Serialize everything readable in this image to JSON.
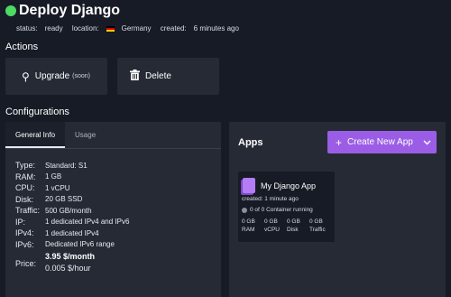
{
  "header": {
    "title": "Deploy Django",
    "status_label": "status:",
    "status_value": "ready",
    "location_label": "location:",
    "location_value": "Germany",
    "created_label": "created:",
    "created_value": "6 minutes ago"
  },
  "actions": {
    "title": "Actions",
    "upgrade_label": "Upgrade",
    "upgrade_note": "(soon)",
    "delete_label": "Delete"
  },
  "configurations": {
    "title": "Configurations",
    "tabs": [
      "General Info",
      "Usage"
    ],
    "specs": [
      {
        "key": "Type:",
        "value": "Standard:  S1"
      },
      {
        "key": "RAM:",
        "value": "1 GB"
      },
      {
        "key": "CPU:",
        "value": "1 vCPU"
      },
      {
        "key": "Disk:",
        "value": "20 GB SSD"
      },
      {
        "key": "Traffic:",
        "value": "500 GB/month"
      },
      {
        "key": "IP:",
        "value": "1 dedicated IPv4 and IPv6"
      },
      {
        "key": "IPv4:",
        "value": "1 dedicated IPv4"
      },
      {
        "key": "IPv6:",
        "value": "Dedicated IPv6 range"
      }
    ],
    "price_label": "Price:",
    "price_month": "3.95 $/month",
    "price_hour": "0.005 $/hour"
  },
  "apps": {
    "title": "Apps",
    "create_label": "Create New App",
    "card": {
      "name": "My Django App",
      "created": "created: 1 minute ago",
      "status": "0 of 0 Container running",
      "stats": [
        {
          "value": "0 GB",
          "label": "RAM"
        },
        {
          "value": "0 GB",
          "label": "vCPU"
        },
        {
          "value": "0 GB",
          "label": "Disk"
        },
        {
          "value": "0 GB",
          "label": "Traffic"
        }
      ]
    }
  },
  "colors": {
    "background": "#171b25",
    "panel": "#252a35",
    "accent": "#9b5de5",
    "status_ready": "#4cd964"
  },
  "icons": [
    "status-dot-icon",
    "germany-flag-icon",
    "upgrade-icon",
    "trash-icon",
    "plus-icon",
    "chevron-down-icon",
    "app-icon"
  ]
}
